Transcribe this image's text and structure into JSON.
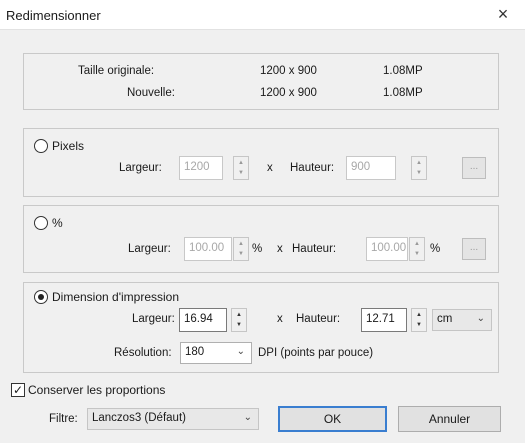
{
  "window": {
    "title": "Redimensionner",
    "close_glyph": "×"
  },
  "info": {
    "original_label": "Taille originale:",
    "original_size": "1200 x 900",
    "original_mp": "1.08MP",
    "new_label": "Nouvelle:",
    "new_size": "1200 x 900",
    "new_mp": "1.08MP"
  },
  "pixels": {
    "label": "Pixels",
    "selected": false,
    "width_label": "Largeur:",
    "width_value": "1200",
    "x": "x",
    "height_label": "Hauteur:",
    "height_value": "900",
    "dots": "..."
  },
  "percent": {
    "label": "%",
    "selected": false,
    "width_label": "Largeur:",
    "width_value": "100.00",
    "width_unit": "%",
    "x": "x",
    "height_label": "Hauteur:",
    "height_value": "100.00",
    "height_unit": "%",
    "dots": "..."
  },
  "print": {
    "label": "Dimension d'impression",
    "selected": true,
    "width_label": "Largeur:",
    "width_value": "16.94",
    "x": "x",
    "height_label": "Hauteur:",
    "height_value": "12.71",
    "unit": "cm",
    "resolution_label": "Résolution:",
    "resolution_value": "180",
    "resolution_unit": "DPI (points par pouce)"
  },
  "keep_proportions": {
    "label": "Conserver les proportions",
    "checked": true,
    "mark": "✓"
  },
  "filter": {
    "label": "Filtre:",
    "value": "Lanczos3 (Défaut)"
  },
  "buttons": {
    "ok": "OK",
    "cancel": "Annuler"
  },
  "icons": {
    "spin_up": "▲",
    "spin_down": "▼",
    "dropdown": "⌄"
  }
}
